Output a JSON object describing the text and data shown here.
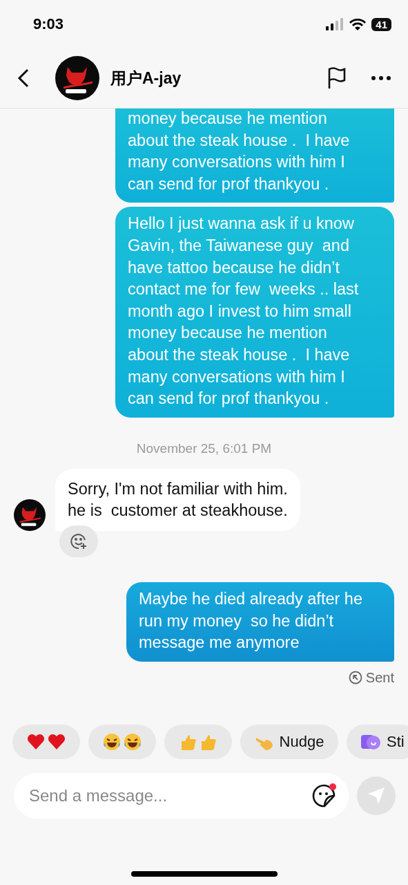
{
  "status_bar": {
    "time": "9:03",
    "battery": "41"
  },
  "header": {
    "name": "用户A-jay"
  },
  "messages": [
    {
      "kind": "outgoing",
      "cut": true,
      "text": "money because he mention\nabout the steak house .  I have\nmany conversations with him I\ncan send for prof thankyou ."
    },
    {
      "kind": "outgoing",
      "cut": false,
      "text": "Hello I just wanna ask if u know\nGavin, the Taiwanese guy  and\nhave tattoo because he didn’t\ncontact me for few  weeks .. last\nmonth ago I invest to him small\nmoney because he mention\nabout the steak house .  I have\nmany conversations with him I\ncan send for prof thankyou ."
    },
    {
      "kind": "timestamp",
      "text": "November 25, 6:01 PM"
    },
    {
      "kind": "incoming",
      "text": "Sorry, I'm not familiar with him.\nhe is  customer at steakhouse."
    },
    {
      "kind": "outgoing",
      "cut": false,
      "deep": true,
      "text": "Maybe he died already after he\nrun my money  so he didn’t\nmessage me anymore"
    },
    {
      "kind": "status",
      "text": "Sent"
    }
  ],
  "quick_replies": [
    {
      "kind": "hearts"
    },
    {
      "kind": "laughing"
    },
    {
      "kind": "thumbs"
    },
    {
      "kind": "nudge",
      "label": "Nudge"
    },
    {
      "kind": "sticker",
      "label": "Sti"
    }
  ],
  "composer": {
    "placeholder": "Send a message..."
  }
}
